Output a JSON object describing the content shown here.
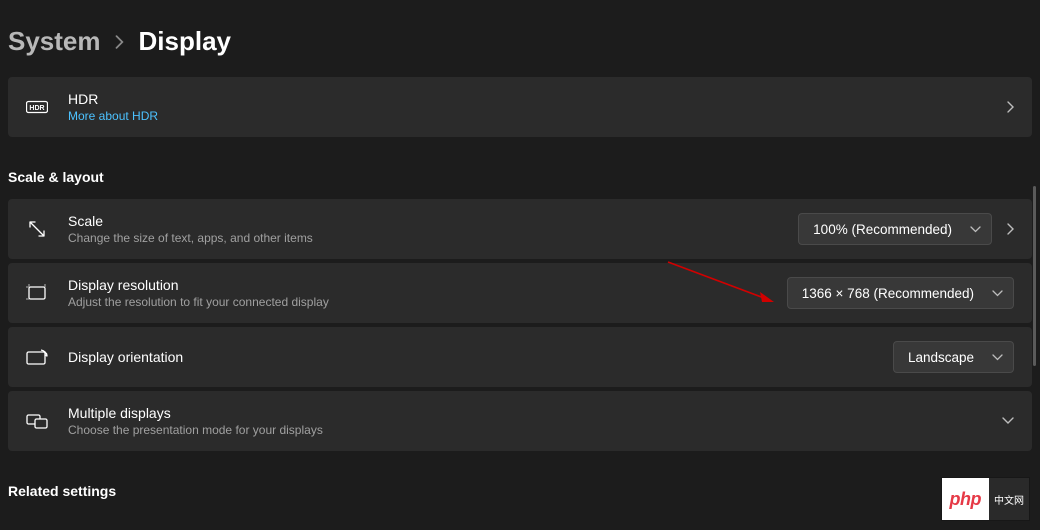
{
  "breadcrumb": {
    "parent": "System",
    "current": "Display"
  },
  "hdr": {
    "title": "HDR",
    "link": "More about HDR"
  },
  "sections": {
    "scale_layout": "Scale & layout",
    "related": "Related settings"
  },
  "scale": {
    "title": "Scale",
    "sub": "Change the size of text, apps, and other items",
    "value": "100% (Recommended)"
  },
  "resolution": {
    "title": "Display resolution",
    "sub": "Adjust the resolution to fit your connected display",
    "value": "1366 × 768 (Recommended)"
  },
  "orientation": {
    "title": "Display orientation",
    "value": "Landscape"
  },
  "multi": {
    "title": "Multiple displays",
    "sub": "Choose the presentation mode for your displays"
  },
  "watermark": {
    "left": "php",
    "right": "中文网"
  }
}
